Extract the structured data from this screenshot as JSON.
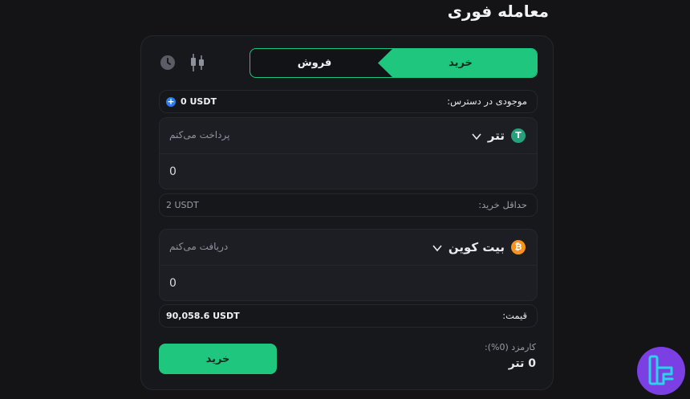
{
  "page": {
    "title": "معامله فوری"
  },
  "tabs": {
    "buy": "خرید",
    "sell": "فروش"
  },
  "balance": {
    "label": "موجودی در دسترس:",
    "value": "0 USDT"
  },
  "pay": {
    "coin": "تتر",
    "coin_symbol": "T",
    "hint": "پرداخت می‌کنم",
    "amount": "0"
  },
  "min_buy": {
    "label": "حداقل خرید:",
    "value": "2 USDT"
  },
  "receive": {
    "coin": "بیت کوین",
    "coin_symbol": "₿",
    "hint": "دریافت می‌کنم",
    "amount": "0"
  },
  "price": {
    "label": "قیمت:",
    "value": "90,058.6 USDT"
  },
  "fee": {
    "label": "کارمزد (0%):",
    "value": "0 تتر"
  },
  "actions": {
    "buy_label": "خرید"
  },
  "colors": {
    "accent": "#1fc77e",
    "background": "#141416",
    "panel": "#17181c",
    "usdt": "#26a17b",
    "btc": "#f7931a",
    "brand": "#7b3fe4"
  }
}
